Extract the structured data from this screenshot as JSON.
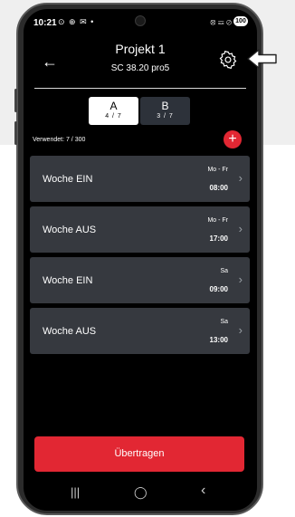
{
  "status_bar": {
    "time": "10:21",
    "left_icons": "⊙ ⊕ ✉ •",
    "right_icons": "⦻ ☲ ⊘",
    "battery": "100"
  },
  "header": {
    "title": "Projekt 1",
    "subtitle": "SC 38.20 pro5",
    "back_icon": "arrow-left-icon",
    "settings_icon": "gear-icon"
  },
  "segments": [
    {
      "label": "A",
      "count": "4 / 7"
    },
    {
      "label": "B",
      "count": "3 / 7"
    }
  ],
  "used_text": "Verwendet: 7 / 300",
  "add_icon": "plus-icon",
  "schedule": [
    {
      "name": "Woche EIN",
      "days": "Mo - Fr",
      "time": "08:00"
    },
    {
      "name": "Woche AUS",
      "days": "Mo - Fr",
      "time": "17:00"
    },
    {
      "name": "Woche EIN",
      "days": "Sa",
      "time": "09:00"
    },
    {
      "name": "Woche AUS",
      "days": "Sa",
      "time": "13:00"
    }
  ],
  "submit_label": "Übertragen",
  "navbar": {
    "recents": "|||",
    "home": "◯",
    "back": "‹"
  },
  "colors": {
    "accent": "#e22733",
    "card": "#36393f",
    "screen_bg": "#000000"
  }
}
